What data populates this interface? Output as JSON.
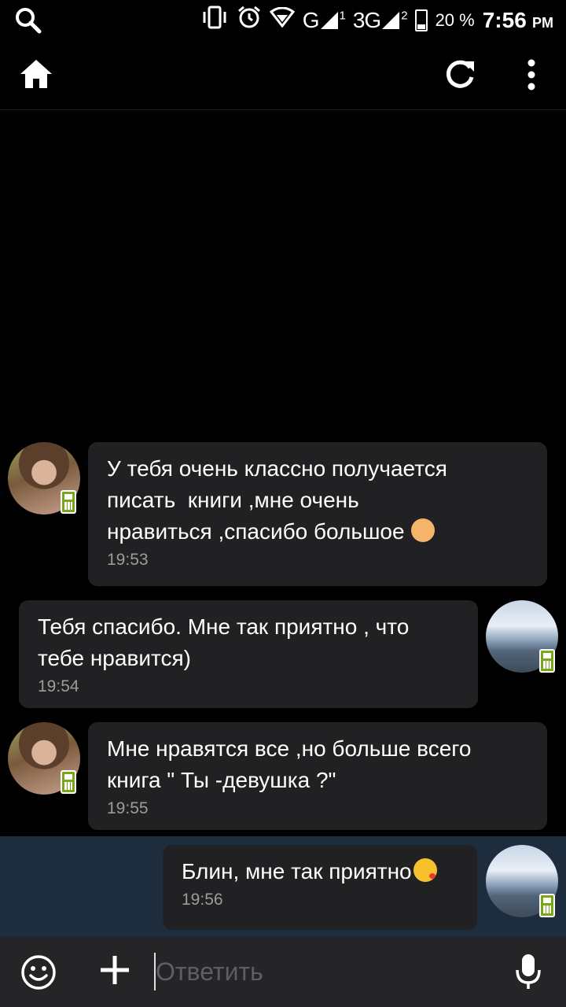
{
  "status_bar": {
    "search_icon": "search-icon",
    "icons": [
      "vibrate-icon",
      "alarm-icon",
      "wifi-icon"
    ],
    "sim1_label": "G",
    "sim1_index": "1",
    "sim2_label": "3G",
    "sim2_index": "2",
    "battery_level": 0.2,
    "battery_percent": "20 %",
    "time": "7:56",
    "am_pm": "PM"
  },
  "app_bar": {
    "home_icon": "home-icon",
    "refresh_icon": "refresh-icon",
    "more_icon": "more-vertical-icon"
  },
  "messages": [
    {
      "side": "left",
      "avatar": "girl-avatar",
      "text": "У тебя очень классно получается\nписать  книги ,мне очень\nнравиться ,спасибо большое",
      "emoji": "ok-hand-emoji",
      "time": "19:53"
    },
    {
      "side": "right",
      "avatar": "sea-avatar",
      "text": "Тебя спасибо. Мне так приятно , что\nтебе нравится)",
      "time": "19:54"
    },
    {
      "side": "left",
      "avatar": "girl-avatar",
      "text": "Мне нравятся все ,но больше всего\nкнига \" Ты -девушка ?\"",
      "time": "19:55"
    },
    {
      "side": "right",
      "avatar": "sea-avatar",
      "text": "Блин, мне так приятно",
      "emoji": "kiss-emoji",
      "time": "19:56",
      "highlighted": true
    }
  ],
  "input_bar": {
    "emoji_icon": "smiley-icon",
    "add_icon": "plus-icon",
    "placeholder": "Ответить",
    "mic_icon": "microphone-icon"
  },
  "colors": {
    "background": "#000000",
    "bubble": "#212124",
    "highlight": "#1e2d3d",
    "input_bar": "#252528",
    "timestamp": "#9c9c9c",
    "online_badge": "#78a81a"
  }
}
